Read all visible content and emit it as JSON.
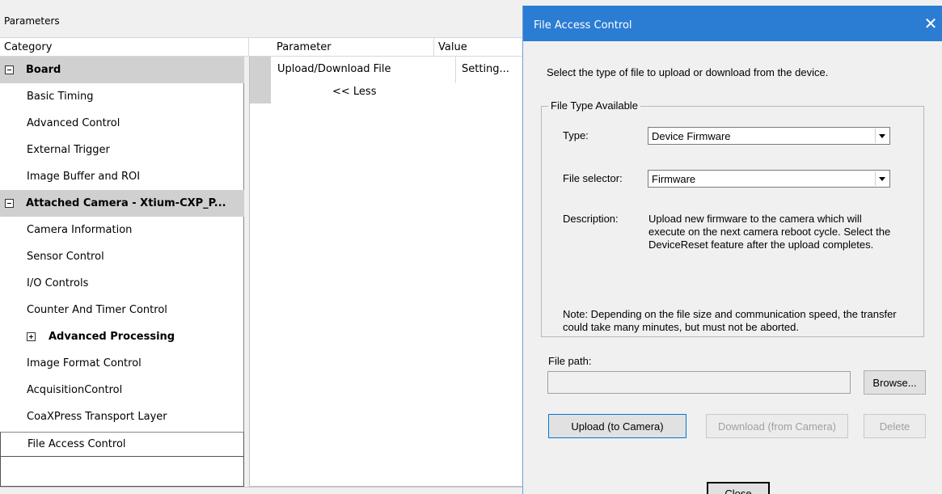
{
  "params_window": {
    "title": "Parameters",
    "col_category": "Category",
    "col_parameter": "Parameter",
    "col_value": "Value",
    "categories": [
      {
        "label": "Board",
        "type": "group"
      },
      {
        "label": "Basic Timing",
        "type": "item"
      },
      {
        "label": "Advanced Control",
        "type": "item"
      },
      {
        "label": "External Trigger",
        "type": "item"
      },
      {
        "label": "Image Buffer and ROI",
        "type": "item"
      },
      {
        "label": "Attached Camera - Xtium-CXP_P...",
        "type": "group"
      },
      {
        "label": "Camera Information",
        "type": "item"
      },
      {
        "label": "Sensor Control",
        "type": "item"
      },
      {
        "label": "I/O Controls",
        "type": "item"
      },
      {
        "label": "Counter And Timer Control",
        "type": "item"
      },
      {
        "label": "Advanced Processing",
        "type": "collapsed"
      },
      {
        "label": "Image Format Control",
        "type": "item"
      },
      {
        "label": "AcquisitionControl",
        "type": "item"
      },
      {
        "label": "CoaXPress Transport Layer",
        "type": "item"
      }
    ],
    "selected_category": "File Access Control",
    "parameter_name": "Upload/Download File",
    "parameter_value": "Setting...",
    "less_link": "<< Less"
  },
  "dialog": {
    "title": "File Access Control",
    "close_glyph": "✕",
    "intro": "Select the type of file to upload or download from the device.",
    "group_title": "File Type Available",
    "type_label": "Type:",
    "type_value": "Device Firmware",
    "selector_label": "File selector:",
    "selector_value": "Firmware",
    "description_label": "Description:",
    "description_text": "Upload new firmware to the camera which will execute on the next camera reboot cycle. Select the DeviceReset feature after the upload completes.",
    "note": "Note: Depending on the file size and communication speed, the transfer could take many minutes, but must not be aborted.",
    "filepath_label": "File path:",
    "filepath_value": "",
    "browse_label": "Browse...",
    "upload_label": "Upload (to Camera)",
    "download_label": "Download (from Camera)",
    "delete_label": "Delete",
    "close_label": "Close"
  },
  "colors": {
    "titlebar_blue": "#2b7cd3",
    "group_row_gray": "#d0d0d0"
  }
}
